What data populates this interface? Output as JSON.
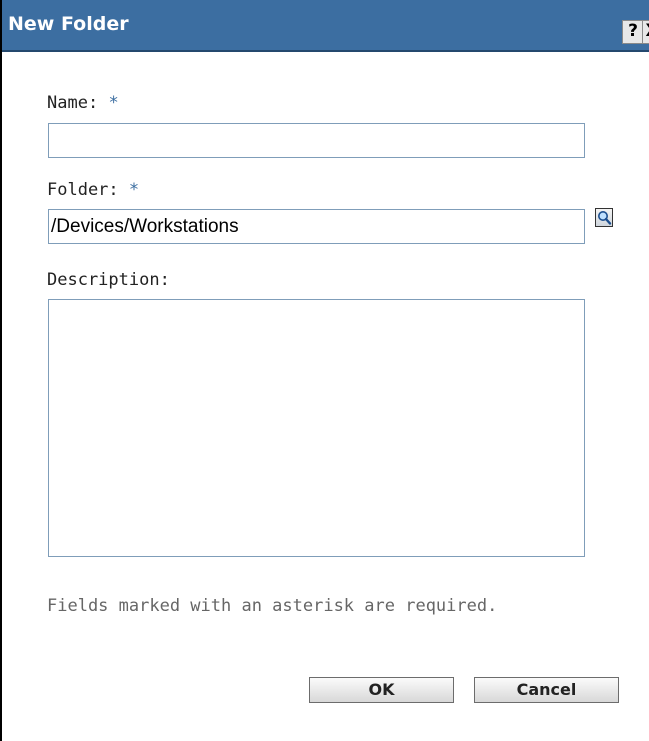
{
  "dialog": {
    "title": "New Folder",
    "help_label": "?",
    "close_label": "X"
  },
  "form": {
    "name_label": "Name:",
    "name_required": "*",
    "name_value": "",
    "folder_label": "Folder:",
    "folder_required": "*",
    "folder_value": "/Devices/Workstations",
    "description_label": "Description:",
    "description_value": "",
    "required_note": "Fields marked with an asterisk are required."
  },
  "buttons": {
    "ok_label": "OK",
    "cancel_label": "Cancel"
  },
  "icons": {
    "browse": "magnifier-icon"
  },
  "colors": {
    "titlebar": "#3c6ea1",
    "accent": "#3c6ea1"
  }
}
